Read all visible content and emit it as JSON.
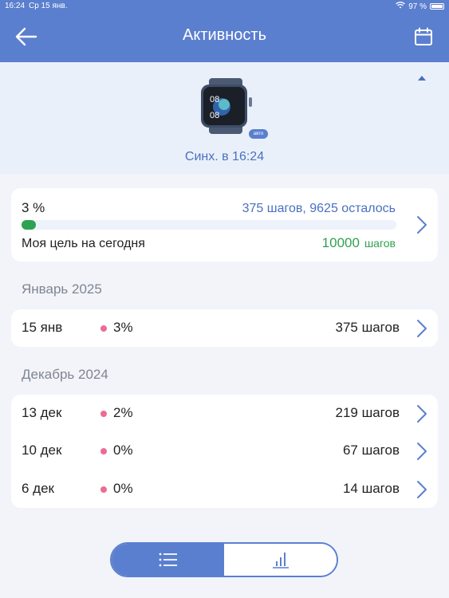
{
  "status_bar": {
    "time": "16:24",
    "date": "Ср 15 янв.",
    "battery": "97 %"
  },
  "header": {
    "title": "Активность",
    "back_icon": "arrow-left-icon",
    "calendar_icon": "calendar-icon"
  },
  "device": {
    "auto_badge": "авто",
    "sync_text": "Синх. в 16:24",
    "watch_time_top": "08",
    "watch_time_bottom": "08"
  },
  "goal": {
    "percent_text": "3 %",
    "progress": 0.0375,
    "steps_text": "375 шагов, 9625 осталось",
    "label": "Моя цель на сегодня",
    "target_value": "10000",
    "target_unit": "шагов"
  },
  "sections": [
    {
      "title": "Январь 2025",
      "rows": [
        {
          "date": "15 янв",
          "percent": "3%",
          "steps": "375 шагов"
        }
      ]
    },
    {
      "title": "Декабрь 2024",
      "rows": [
        {
          "date": "13 дек",
          "percent": "2%",
          "steps": "219 шагов"
        },
        {
          "date": "10 дек",
          "percent": "0%",
          "steps": "67 шагов"
        },
        {
          "date": "6 дек",
          "percent": "0%",
          "steps": "14 шагов"
        }
      ]
    }
  ],
  "bottom_tabs": {
    "list_icon": "list-icon",
    "chart_icon": "bar-chart-icon",
    "selected": "list"
  },
  "colors": {
    "accent": "#5b7fcf",
    "goal_green": "#2ea24f",
    "dot_pink": "#ee6b92"
  }
}
